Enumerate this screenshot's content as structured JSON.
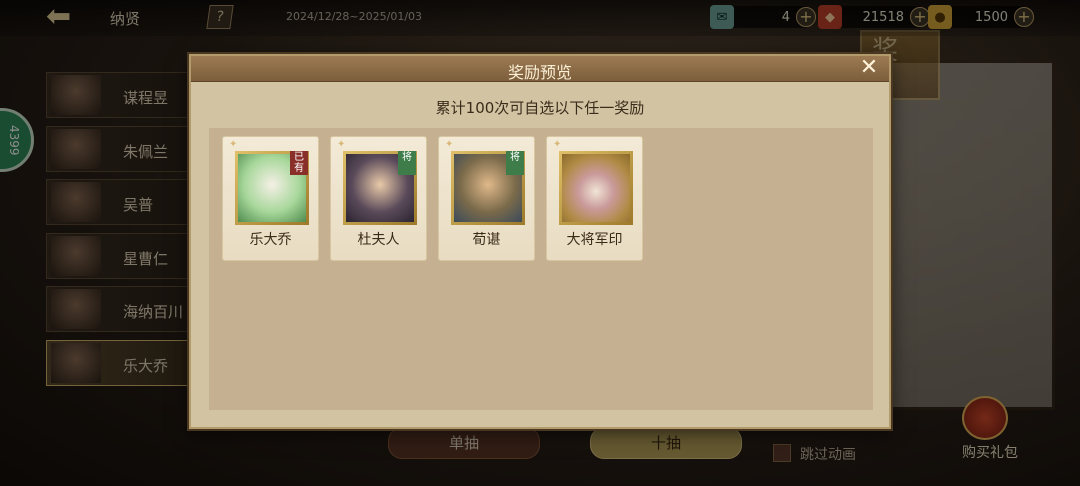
{
  "top_bar": {
    "back_icon": "back-arrow-icon",
    "title": "纳贤",
    "help_label": "?",
    "date_range": "2024/12/28~2025/01/03",
    "resources": [
      {
        "icon": "ticket-icon",
        "glyph": "✉",
        "value": "4"
      },
      {
        "icon": "ingot-icon",
        "glyph": "◆",
        "value": "21518"
      },
      {
        "icon": "gold-icon",
        "glyph": "●",
        "value": "1500"
      }
    ],
    "plus_label": "+"
  },
  "hero_list": [
    {
      "name": "谋程昱"
    },
    {
      "name": "朱佩兰"
    },
    {
      "name": "吴普"
    },
    {
      "name": "星曹仁"
    },
    {
      "name": "海纳百川"
    },
    {
      "name": "乐大乔"
    }
  ],
  "badge_text": "4399",
  "background_banner": "奖",
  "bottom": {
    "single_draw": "单抽",
    "ten_draw": "十抽",
    "skip_animation": "跳过动画",
    "buy_gift": "购买礼包"
  },
  "dialog": {
    "title": "奖励预览",
    "close_label": "✕",
    "subtitle": "累计100次可自选以下任一奖励",
    "rewards": [
      {
        "name": "乐大乔",
        "tag": "已有"
      },
      {
        "name": "杜夫人",
        "tag": "将"
      },
      {
        "name": "荀谌",
        "tag": "将"
      },
      {
        "name": "大将军印",
        "tag": ""
      }
    ]
  },
  "colors": {
    "dialog_bg": "#d2c3a3",
    "header_bg": "#8d6c47",
    "reward_area_bg": "#c5b092",
    "card_bg": "#f0e6d0",
    "general_tag": "#3e7d4a",
    "owned_tag": "#8a2e2a"
  }
}
